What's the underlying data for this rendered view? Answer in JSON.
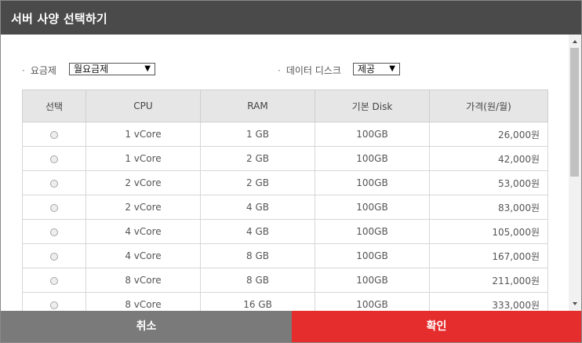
{
  "dialog": {
    "title": "서버 사양 선택하기",
    "colors": {
      "titlebar": "#4a4a4a",
      "ok": "#e52d2d",
      "cancel": "#7a7a7a"
    }
  },
  "filters": {
    "plan_label": "요금제",
    "plan_value": "월요금제",
    "disk_label": "데이터 디스크",
    "disk_value": "제공"
  },
  "table": {
    "headers": [
      "선택",
      "CPU",
      "RAM",
      "기본 Disk",
      "가격(원/월)"
    ],
    "rows": [
      {
        "cpu": "1 vCore",
        "ram": "1 GB",
        "disk": "100GB",
        "price": "26,000원"
      },
      {
        "cpu": "1 vCore",
        "ram": "2 GB",
        "disk": "100GB",
        "price": "42,000원"
      },
      {
        "cpu": "2 vCore",
        "ram": "2 GB",
        "disk": "100GB",
        "price": "53,000원"
      },
      {
        "cpu": "2 vCore",
        "ram": "4 GB",
        "disk": "100GB",
        "price": "83,000원"
      },
      {
        "cpu": "4 vCore",
        "ram": "4 GB",
        "disk": "100GB",
        "price": "105,000원"
      },
      {
        "cpu": "4 vCore",
        "ram": "8 GB",
        "disk": "100GB",
        "price": "167,000원"
      },
      {
        "cpu": "8 vCore",
        "ram": "8 GB",
        "disk": "100GB",
        "price": "211,000원"
      },
      {
        "cpu": "8 vCore",
        "ram": "16 GB",
        "disk": "100GB",
        "price": "333,000원"
      }
    ]
  },
  "footer": {
    "cancel_label": "취소",
    "ok_label": "확인"
  }
}
